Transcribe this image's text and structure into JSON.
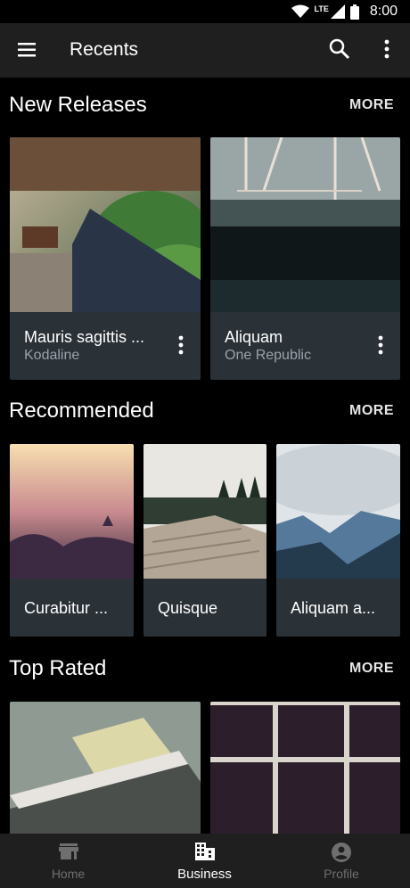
{
  "status_bar": {
    "time": "8:00",
    "network": "LTE"
  },
  "app_bar": {
    "title": "Recents"
  },
  "sections": {
    "new_releases": {
      "title": "New Releases",
      "more": "MORE",
      "cards": [
        {
          "title": "Mauris sagittis ...",
          "subtitle": "Kodaline"
        },
        {
          "title": "Aliquam",
          "subtitle": "One Republic"
        }
      ]
    },
    "recommended": {
      "title": "Recommended",
      "more": "MORE",
      "cards": [
        {
          "title": "Curabitur ..."
        },
        {
          "title": "Quisque"
        },
        {
          "title": "Aliquam a..."
        }
      ]
    },
    "top_rated": {
      "title": "Top Rated",
      "more": "MORE"
    }
  },
  "bottom_nav": {
    "items": [
      {
        "label": "Home",
        "icon": "store-icon",
        "active": false
      },
      {
        "label": "Business",
        "icon": "business-icon",
        "active": true
      },
      {
        "label": "Profile",
        "icon": "profile-icon",
        "active": false
      }
    ]
  },
  "colors": {
    "appbar": "#1f1f1f",
    "card": "#2a3137",
    "inactive_nav": "#6f6f6f",
    "subtitle": "#9aa3aa"
  }
}
